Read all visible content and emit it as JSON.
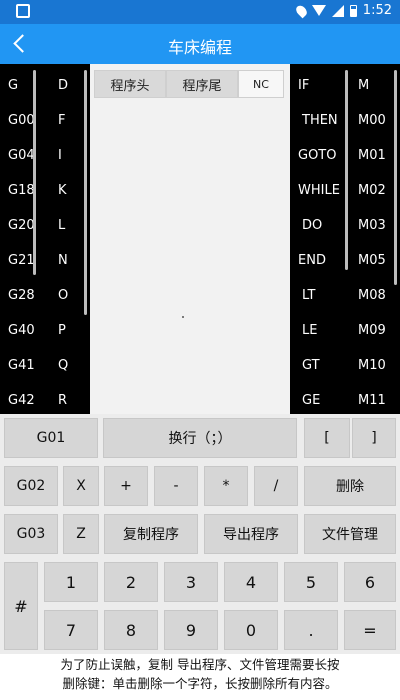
{
  "status_bar": {
    "time": "1:52"
  },
  "app_bar": {
    "title": "车床编程"
  },
  "left_panel": {
    "col1": [
      "G",
      "G00",
      "G04",
      "G18",
      "G20",
      "G21",
      "G28",
      "G40",
      "G41",
      "G42"
    ],
    "col2": [
      "D",
      "F",
      "I",
      "K",
      "L",
      "N",
      "O",
      "P",
      "Q",
      "R"
    ]
  },
  "right_panel": {
    "col1": [
      "IF",
      "THEN",
      "GOTO",
      "WHILE",
      "DO",
      "END",
      "LT",
      "LE",
      "GT",
      "GE"
    ],
    "col2": [
      "M",
      "M00",
      "M01",
      "M02",
      "M03",
      "M05",
      "M08",
      "M09",
      "M10",
      "M11"
    ]
  },
  "editor_tabs": {
    "tab1": "程序头",
    "tab2": "程序尾",
    "tab3": "NC"
  },
  "keypad": {
    "r1": {
      "g01": "G01",
      "newline": "换行（；）",
      "lbracket": "[",
      "rbracket": "]"
    },
    "r2": {
      "g02": "G02",
      "x": "X",
      "plus": "+",
      "minus": "-",
      "star": "*",
      "slash": "/",
      "delete": "删除"
    },
    "r3": {
      "g03": "G03",
      "z": "Z",
      "copy": "复制程序",
      "export": "导出程序",
      "files": "文件管理"
    },
    "r4": {
      "hash": "#",
      "n1": "1",
      "n2": "2",
      "n3": "3",
      "n4": "4",
      "n5": "5",
      "n6": "6"
    },
    "r5": {
      "n7": "7",
      "n8": "8",
      "n9": "9",
      "n0": "0",
      "dot": ".",
      "eq": "="
    }
  },
  "footer": {
    "line1": "为了防止误触，复制 导出程序、文件管理需要长按",
    "line2": "删除键：单击删除一个字符，长按删除所有内容。"
  }
}
